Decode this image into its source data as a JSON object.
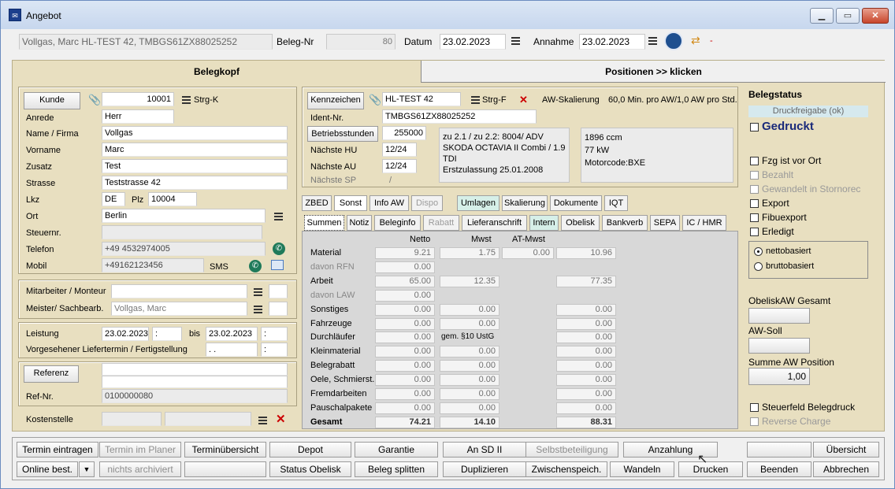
{
  "window": {
    "title": "Angebot"
  },
  "header": {
    "customer_summary": "Vollgas, Marc HL-TEST 42, TMBGS61ZX88025252",
    "beleg_nr_label": "Beleg-Nr",
    "beleg_nr": "80",
    "datum_label": "Datum",
    "datum": "23.02.2023",
    "annahme_label": "Annahme",
    "annahme": "23.02.2023",
    "dash": "-"
  },
  "sections": {
    "belegkopf": "Belegkopf",
    "positionen": "Positionen >> klicken"
  },
  "kunde": {
    "button": "Kunde",
    "nr": "10001",
    "strg_k": "Strg-K",
    "anrede_label": "Anrede",
    "anrede": "Herr",
    "name_label": "Name / Firma",
    "name": "Vollgas",
    "vorname_label": "Vorname",
    "vorname": "Marc",
    "zusatz_label": "Zusatz",
    "zusatz": "Test",
    "strasse_label": "Strasse",
    "strasse": "Teststrasse 42",
    "lkz_label": "Lkz",
    "lkz": "DE",
    "plz_label": "Plz",
    "plz": "10004",
    "ort_label": "Ort",
    "ort": "Berlin",
    "steuernr_label": "Steuernr.",
    "telefon_label": "Telefon",
    "telefon": "+49 4532974005",
    "mobil_label": "Mobil",
    "mobil": "+49162123456",
    "sms": "SMS"
  },
  "mitarbeiter": {
    "label": "Mitarbeiter / Monteur",
    "meister_label": "Meister/ Sachbearb.",
    "meister": "Vollgas, Marc"
  },
  "leistung": {
    "label": "Leistung",
    "from": "23.02.2023",
    "from_time": ":",
    "bis": "bis",
    "to": "23.02.2023",
    "to_time": ":",
    "liefer_label": "Vorgesehener Liefertermin / Fertigstellung",
    "liefer_date": ". .",
    "liefer_time": ":"
  },
  "referenz": {
    "button": "Referenz",
    "refnr_label": "Ref-Nr.",
    "refnr": "0100000080"
  },
  "kostenstelle": {
    "label": "Kostenstelle"
  },
  "vehicle": {
    "kennzeichen_button": "Kennzeichen",
    "kennzeichen": "HL-TEST 42",
    "strg_f": "Strg-F",
    "aw_skalierung": "AW-Skalierung",
    "aw_text": "60,0 Min. pro AW/1,0 AW pro Std.",
    "ident_label": "Ident-Nr.",
    "ident": "TMBGS61ZX88025252",
    "betrieb_button": "Betriebsstunden",
    "betrieb": "255000",
    "hu_label": "Nächste HU",
    "hu": "12/24",
    "au_label": "Nächste AU",
    "au": "12/24",
    "sp_label": "Nächste SP",
    "sp": "/",
    "info": [
      "zu 2.1 / zu 2.2: 8004/ ADV",
      "SKODA OCTAVIA II Combi / 1.9",
      "TDI",
      "Erstzulassung 25.01.2008"
    ],
    "specs": [
      "1896 ccm",
      "77 kW",
      "Motorcode:BXE"
    ]
  },
  "tabs_top": [
    "ZBED",
    "Sonst",
    "Info AW",
    "Dispo",
    "Umlagen",
    "Skalierung",
    "Dokumente",
    "IQT"
  ],
  "tabs_bottom": [
    "Summen",
    "Notiz",
    "Beleginfo",
    "Rabatt",
    "Lieferanschrift",
    "Intern",
    "Obelisk",
    "Bankverb",
    "SEPA",
    "IC / HMR"
  ],
  "summen": {
    "headers": [
      "Netto",
      "Mwst",
      "AT-Mwst"
    ],
    "rows": [
      {
        "label": "Material",
        "netto": "9.21",
        "mwst": "1.75",
        "at": "0.00",
        "total": "10.96"
      },
      {
        "label": "davon RFN",
        "netto": "0.00"
      },
      {
        "label": "Arbeit",
        "netto": "65.00",
        "mwst": "12.35",
        "total": "77.35"
      },
      {
        "label": "davon LAW",
        "netto": "0.00"
      },
      {
        "label": "Sonstiges",
        "netto": "0.00",
        "mwst": "0.00",
        "total": "0.00"
      },
      {
        "label": "Fahrzeuge",
        "netto": "0.00",
        "mwst": "0.00",
        "total": "0.00"
      },
      {
        "label": "Durchläufer",
        "netto": "0.00",
        "mwst_text": "gem. §10 UstG",
        "total": "0.00"
      },
      {
        "label": "Kleinmaterial",
        "netto": "0.00",
        "mwst": "0.00",
        "total": "0.00"
      },
      {
        "label": "Belegrabatt",
        "netto": "0.00",
        "mwst": "0.00",
        "total": "0.00"
      },
      {
        "label": "Oele, Schmierst.",
        "netto": "0.00",
        "mwst": "0.00",
        "total": "0.00"
      },
      {
        "label": "Fremdarbeiten",
        "netto": "0.00",
        "mwst": "0.00",
        "total": "0.00"
      },
      {
        "label": "Pauschalpakete",
        "netto": "0.00",
        "mwst": "0.00",
        "total": "0.00"
      },
      {
        "label": "Gesamt",
        "netto": "74.21",
        "mwst": "14.10",
        "total": "88.31"
      }
    ]
  },
  "status": {
    "title": "Belegstatus",
    "druckfreigabe": "Druckfreigabe (ok)",
    "gedruckt": "Gedruckt",
    "checks": [
      "Fzg ist vor Ort",
      "Bezahlt",
      "Gewandelt in Stornorec",
      "Export",
      "Fibuexport",
      "Erledigt"
    ],
    "radio1": "nettobasiert",
    "radio2": "bruttobasiert",
    "obelisk_label": "ObeliskAW Gesamt",
    "awsoll_label": "AW-Soll",
    "summe_aw_label": "Summe AW Position",
    "summe_aw": "1,00",
    "steuerfeld": "Steuerfeld Belegdruck",
    "reverse": "Reverse Charge"
  },
  "buttons_row1": [
    "Termin eintragen",
    "Termin im Planer",
    "Terminübersicht",
    "Depot",
    "Garantie",
    "An SD II",
    "Selbstbeteiligung",
    "Anzahlung",
    "",
    "Übersicht"
  ],
  "buttons_row2": [
    "Online best.",
    "nichts archiviert",
    "",
    "Status Obelisk",
    "Beleg splitten",
    "Duplizieren",
    "Zwischenspeich.",
    "Wandeln",
    "Drucken",
    "Beenden",
    "Abbrechen"
  ]
}
